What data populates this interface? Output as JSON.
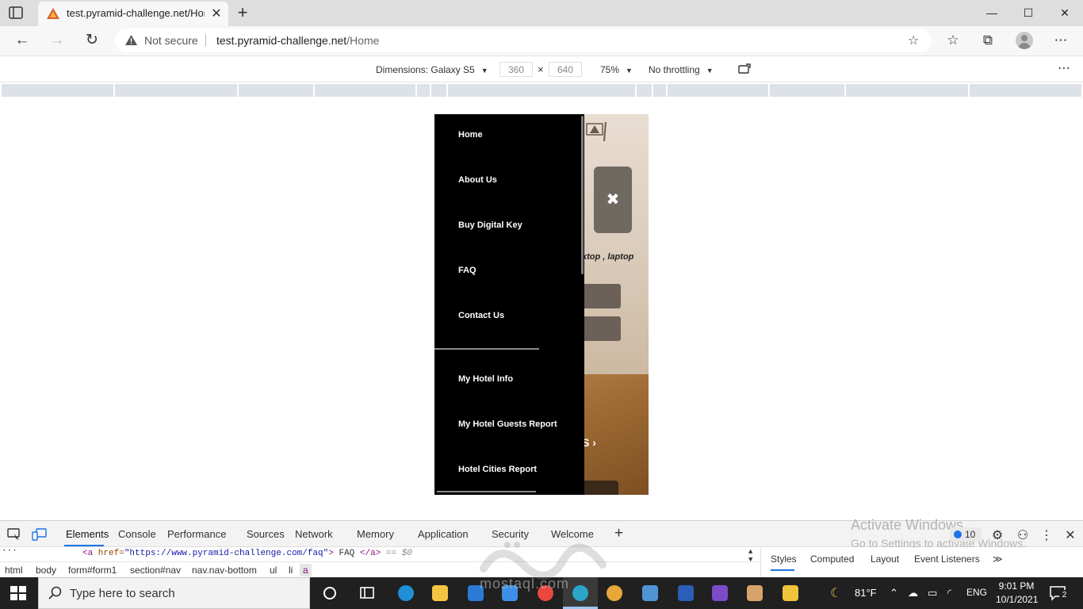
{
  "browser": {
    "tab_title": "test.pyramid-challenge.net/Home",
    "tab_close_glyph": "✕",
    "new_tab_glyph": "+",
    "window_buttons": {
      "minimize": "—",
      "maximize": "☐",
      "close": "✕"
    }
  },
  "addressbar": {
    "security_text": "Not secure",
    "url_host": "test.pyramid-challenge.net",
    "url_path": "/Home"
  },
  "device_toolbar": {
    "dimensions_label": "Dimensions: Galaxy S5",
    "width": "360",
    "height": "640",
    "times": "×",
    "zoom": "75%",
    "throttling": "No throttling",
    "more": "⋮"
  },
  "page": {
    "side_nav": {
      "items": [
        "Home",
        "About Us",
        "Buy Digital Key",
        "FAQ",
        "Contact Us",
        "My Hotel Info",
        "My Hotel Guests Report",
        "Hotel Cities Report"
      ]
    },
    "close_glyph": "✖",
    "description_fragment": "ktop , laptop",
    "link_fragment": "S ›"
  },
  "devtools": {
    "tabs": [
      "Elements",
      "Console",
      "Performance",
      "Sources",
      "Network",
      "Memory",
      "Application",
      "Security",
      "Welcome"
    ],
    "add_glyph": "+",
    "issues_count": "10",
    "code": {
      "tag_open": "<a",
      "attr_name": " href=",
      "attr_value": "\"https://www.pyramid-challenge.com/faq\"",
      "tag_close": ">",
      "text": " FAQ ",
      "end_tag": "</a>",
      "marker": " == $0"
    },
    "breadcrumbs": [
      "html",
      "body",
      "form#form1",
      "section#nav",
      "nav.nav-bottom",
      "ul",
      "li",
      "a"
    ],
    "styles_tabs": [
      "Styles",
      "Computed",
      "Layout",
      "Event Listeners"
    ],
    "styles_more": "≫",
    "activate_title": "Activate Windows",
    "activate_sub": "Go to Settings to activate Windows."
  },
  "taskbar": {
    "search_placeholder": "Type here to search",
    "temperature": "81°F",
    "language": "ENG",
    "time": "9:01 PM",
    "date": "10/1/2021",
    "notifications": "2"
  },
  "watermark": {
    "latin": "mostaql.com"
  },
  "colors": {
    "nav_bg": "#000000",
    "accent": "#1a73e8",
    "taskbar": "#202020"
  }
}
